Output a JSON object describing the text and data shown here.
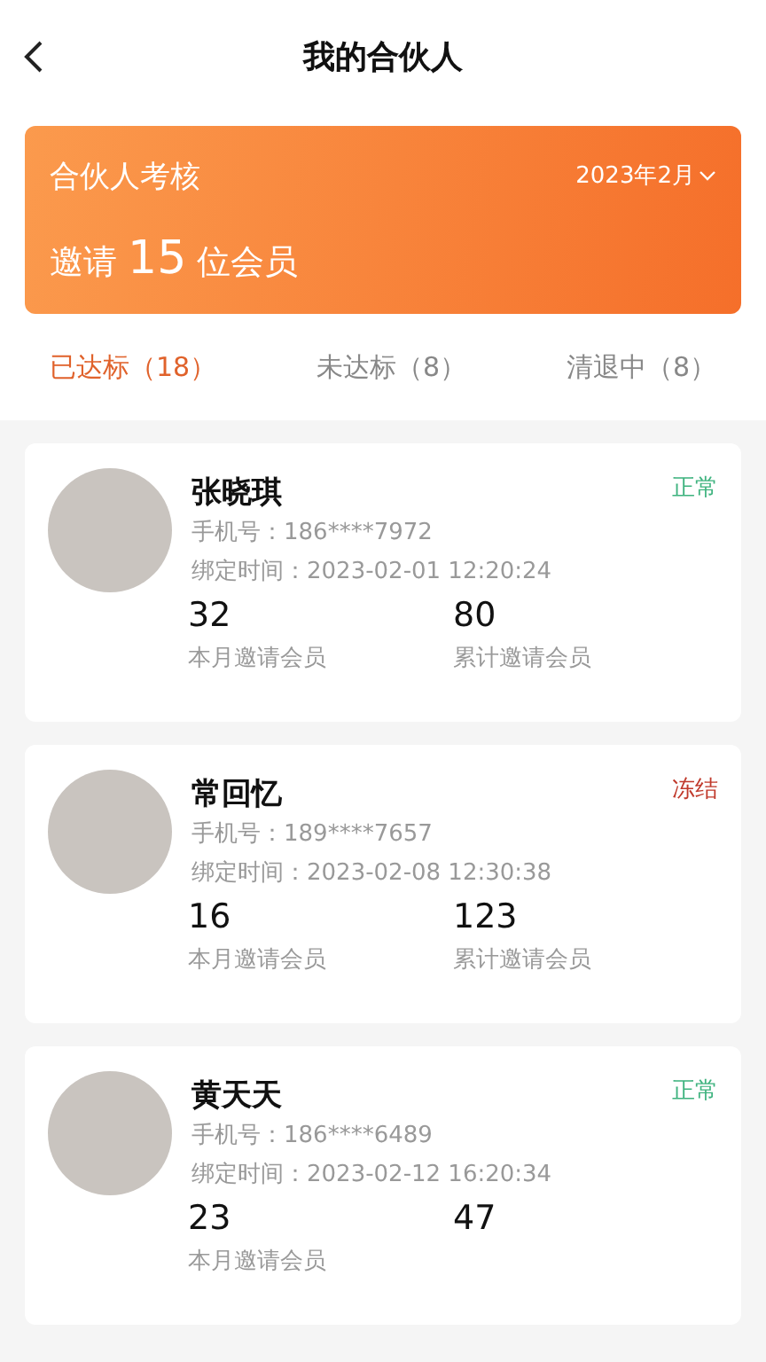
{
  "header": {
    "title": "我的合伙人"
  },
  "banner": {
    "title": "合伙人考核",
    "month": "2023年2月",
    "summary": "邀请 **15** 位会员"
  },
  "tabs": [
    {
      "label": "已达标（18）",
      "selected": true
    },
    {
      "label": "未达标（8）",
      "selected": false
    },
    {
      "label": "清退中（8）",
      "selected": false
    }
  ],
  "partners": [
    {
      "name": "张晓琪",
      "status": "正常",
      "kind": "normal",
      "phone": "手机号：186****7972",
      "bound": "绑定时间：2023-02-01 12:20:24",
      "stats": [
        {
          "value": "32",
          "label": "本月邀请会员"
        },
        {
          "value": "80",
          "label": "累计邀请会员"
        }
      ]
    },
    {
      "name": "常回忆",
      "status": "冻结",
      "kind": "frozen",
      "phone": "手机号：189****7657",
      "bound": "绑定时间：2023-02-08 12:30:38",
      "stats": [
        {
          "value": "16",
          "label": "本月邀请会员"
        },
        {
          "value": "123",
          "label": "累计邀请会员"
        }
      ]
    },
    {
      "name": "黄天天",
      "status": "正常",
      "kind": "normal",
      "phone": "手机号：186****6489",
      "bound": "绑定时间：2023-02-12 16:20:34",
      "stats": [
        {
          "value": "23",
          "label": "本月邀请会员"
        },
        {
          "value": "47"
        }
      ]
    }
  ]
}
